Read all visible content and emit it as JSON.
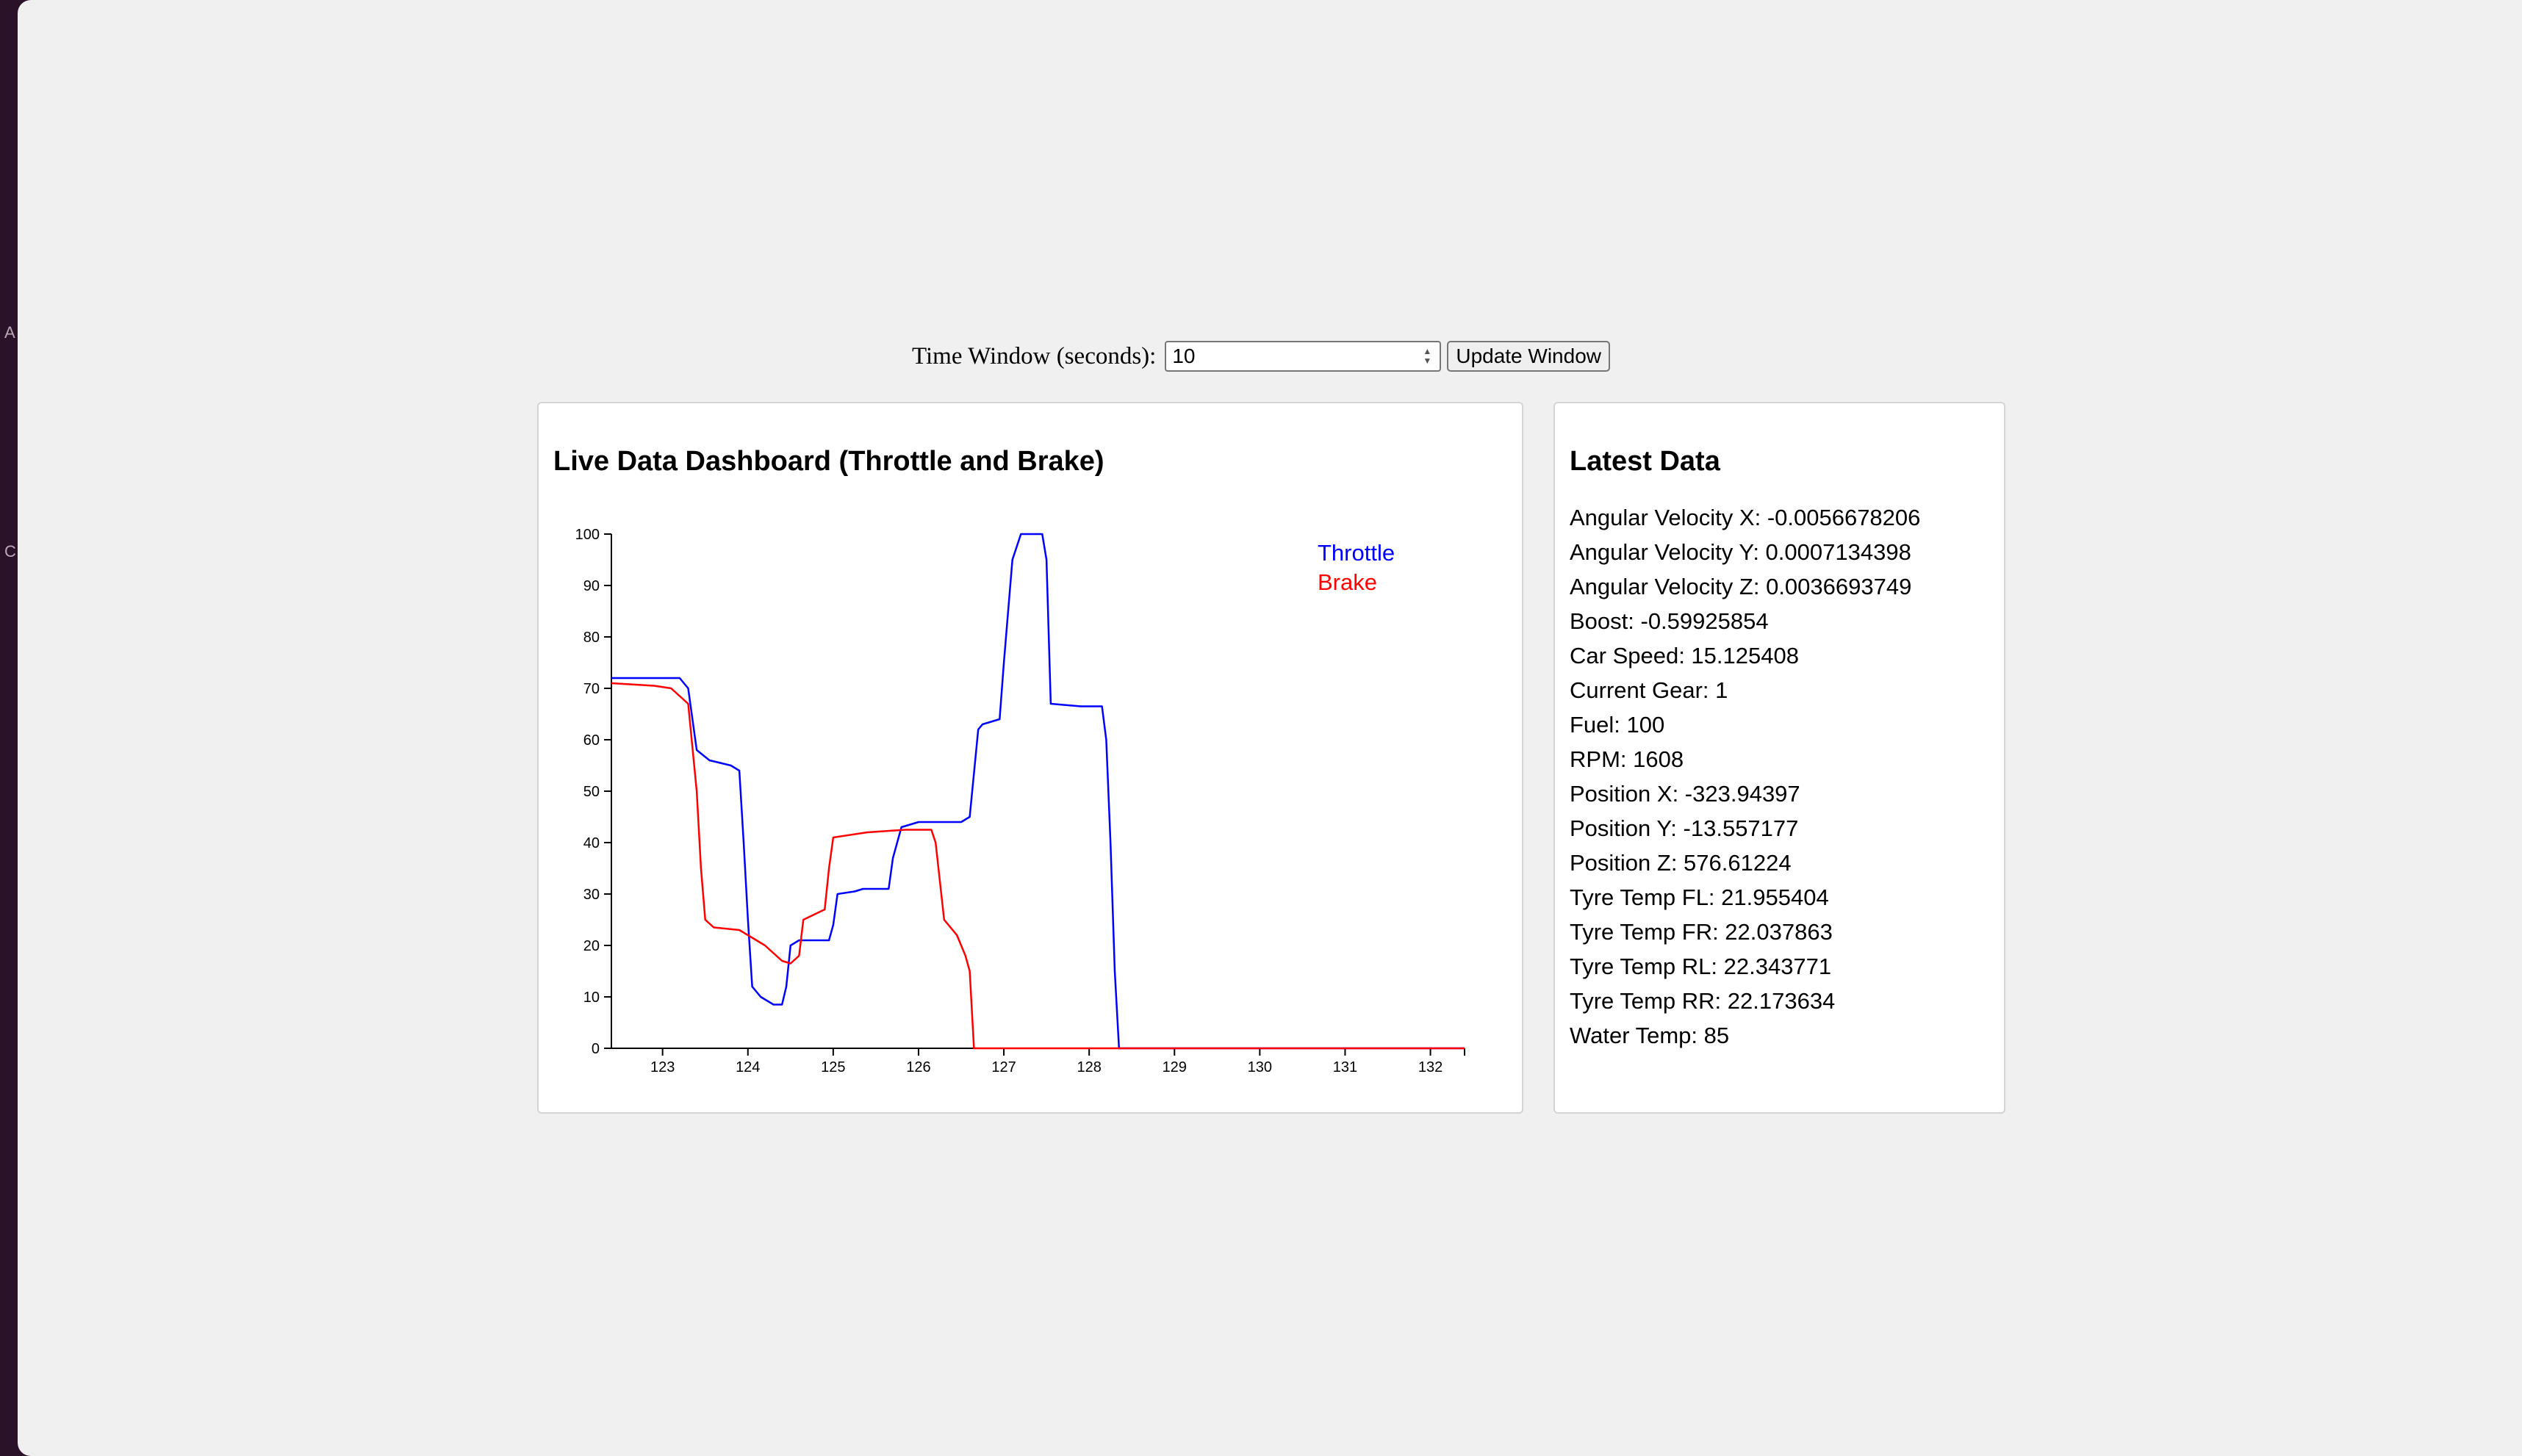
{
  "controls": {
    "time_window_label": "Time Window (seconds):",
    "time_window_value": "10",
    "update_button_label": "Update Window"
  },
  "chart_panel": {
    "title": "Live Data Dashboard (Throttle and Brake)"
  },
  "chart_data": {
    "type": "line",
    "title": "Live Data Dashboard (Throttle and Brake)",
    "xlabel": "",
    "ylabel": "",
    "xlim": [
      122.4,
      132.4
    ],
    "ylim": [
      0,
      100
    ],
    "x_ticks": [
      123,
      124,
      125,
      126,
      127,
      128,
      129,
      130,
      131,
      132
    ],
    "y_ticks": [
      0,
      10,
      20,
      30,
      40,
      50,
      60,
      70,
      80,
      90,
      100
    ],
    "legend_position": "top-right",
    "grid": false,
    "series": [
      {
        "name": "Throttle",
        "color": "#0000ff",
        "x": [
          122.4,
          123.2,
          123.3,
          123.4,
          123.55,
          123.8,
          123.9,
          123.95,
          124.0,
          124.05,
          124.15,
          124.3,
          124.4,
          124.45,
          124.5,
          124.6,
          124.95,
          125.0,
          125.05,
          125.25,
          125.35,
          125.65,
          125.7,
          125.8,
          126.0,
          126.5,
          126.6,
          126.7,
          126.75,
          126.95,
          127.0,
          127.1,
          127.2,
          127.45,
          127.5,
          127.55,
          127.9,
          128.15,
          128.2,
          128.25,
          128.3,
          128.35,
          132.4
        ],
        "values": [
          72,
          72,
          70,
          58,
          56,
          55,
          54,
          40,
          25,
          12,
          10,
          8.5,
          8.5,
          12,
          20,
          21,
          21,
          24,
          30,
          30.5,
          31,
          31,
          37,
          43,
          44,
          44,
          45,
          62,
          63,
          64,
          75,
          95,
          100,
          100,
          95,
          67,
          66.5,
          66.5,
          60,
          40,
          15,
          0,
          0
        ]
      },
      {
        "name": "Brake",
        "color": "#ff0000",
        "x": [
          122.4,
          122.9,
          123.1,
          123.3,
          123.4,
          123.45,
          123.5,
          123.6,
          123.9,
          124.0,
          124.2,
          124.4,
          124.5,
          124.6,
          124.65,
          124.9,
          124.95,
          125.0,
          125.4,
          125.85,
          126.15,
          126.2,
          126.3,
          126.45,
          126.55,
          126.6,
          126.65,
          132.4
        ],
        "values": [
          71,
          70.5,
          70,
          67,
          50,
          35,
          25,
          23.5,
          23,
          22,
          20,
          17,
          16.5,
          18,
          25,
          27,
          35,
          41,
          42,
          42.5,
          42.5,
          40,
          25,
          22,
          18,
          15,
          0,
          0
        ]
      }
    ]
  },
  "data_panel": {
    "title": "Latest Data",
    "items": [
      "Angular Velocity X: -0.0056678206",
      "Angular Velocity Y: 0.0007134398",
      "Angular Velocity Z: 0.0036693749",
      "Boost: -0.59925854",
      "Car Speed: 15.125408",
      "Current Gear: 1",
      "Fuel: 100",
      "RPM: 1608",
      "Position X: -323.94397",
      "Position Y: -13.557177",
      "Position Z: 576.61224",
      "Tyre Temp FL: 21.955404",
      "Tyre Temp FR: 22.037863",
      "Tyre Temp RL: 22.343771",
      "Tyre Temp RR: 22.173634",
      "Water Temp: 85"
    ]
  },
  "edge_glyphs": [
    "A",
    "C"
  ]
}
